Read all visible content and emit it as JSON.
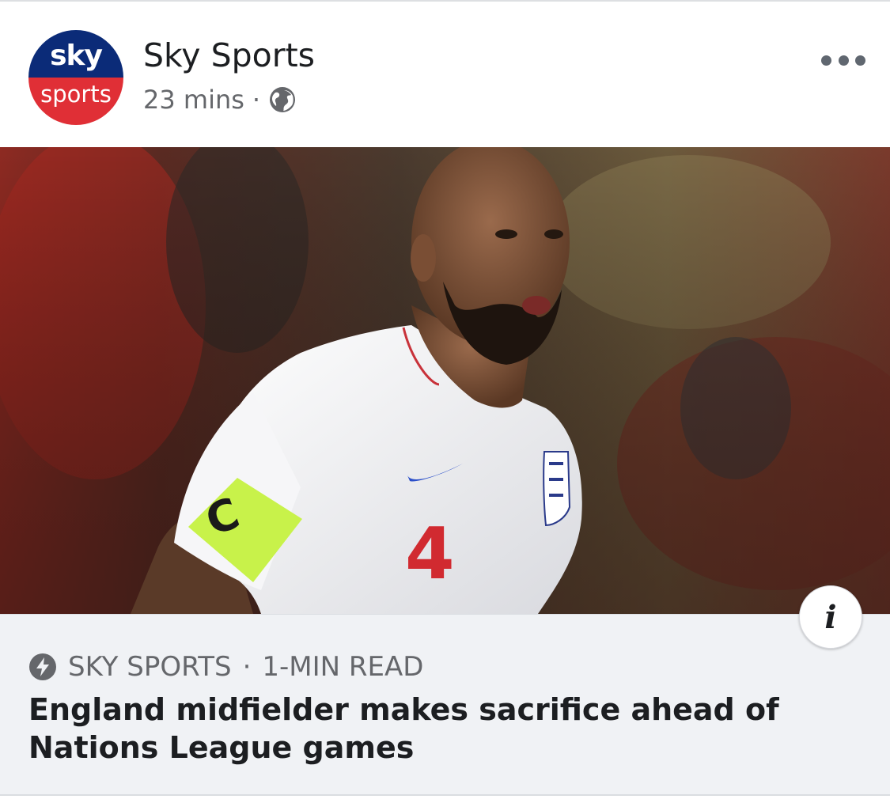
{
  "post": {
    "page_name": "Sky Sports",
    "time": "23 mins",
    "separator": "·",
    "audience_icon": "globe-icon",
    "more_icon": "more-horizontal-icon",
    "avatar": {
      "line1": "sky",
      "line2": "sports",
      "colors": {
        "top": "#0b2b78",
        "bottom": "#e02f36"
      }
    }
  },
  "image": {
    "description_icon": "player-photo",
    "shirt_number": "4",
    "armband_letter": "C"
  },
  "info_button": {
    "label": "i"
  },
  "link_preview": {
    "source": "SKY SPORTS",
    "separator": "·",
    "read_time": "1-MIN READ",
    "source_icon": "lightning-bolt-icon",
    "headline": "England midfielder makes sacrifice ahead of Nations League games"
  }
}
